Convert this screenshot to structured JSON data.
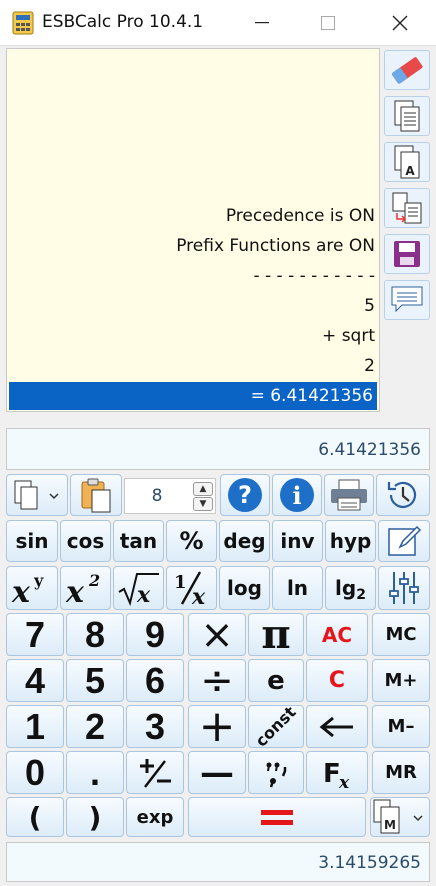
{
  "window": {
    "title": "ESBCalc Pro 10.4.1"
  },
  "tape": {
    "lines": [
      "Precedence is ON",
      "Prefix Functions are ON",
      "- - - - - - - - - - -",
      "5",
      "+ sqrt",
      "2"
    ],
    "result": "= 6.41421356"
  },
  "display": {
    "value": "6.41421356"
  },
  "toolbar": {
    "precision": "8"
  },
  "functions": {
    "sin": "sin",
    "cos": "cos",
    "tan": "tan",
    "percent": "%",
    "deg": "deg",
    "inv": "inv",
    "hyp": "hyp",
    "log": "log",
    "ln": "ln",
    "lg2": "lg",
    "lg2_sub": "2"
  },
  "keys": {
    "d7": "7",
    "d8": "8",
    "d9": "9",
    "times": "×",
    "pi": "π",
    "ac": "AC",
    "mc": "MC",
    "d4": "4",
    "d5": "5",
    "d6": "6",
    "divide": "÷",
    "e": "e",
    "c": "C",
    "mplus": "M+",
    "d1": "1",
    "d2": "2",
    "d3": "3",
    "plus": "+",
    "const": "const",
    "mminus": "M–",
    "d0": "0",
    "dot": ".",
    "minus": "—",
    "mr": "MR",
    "lparen": "(",
    "rparen": ")",
    "exp": "exp"
  },
  "memory": {
    "value": "3.14159265"
  },
  "colors": {
    "accent": "#0a64c6",
    "tape_bg": "#fffde6",
    "red": "#e5151a"
  }
}
